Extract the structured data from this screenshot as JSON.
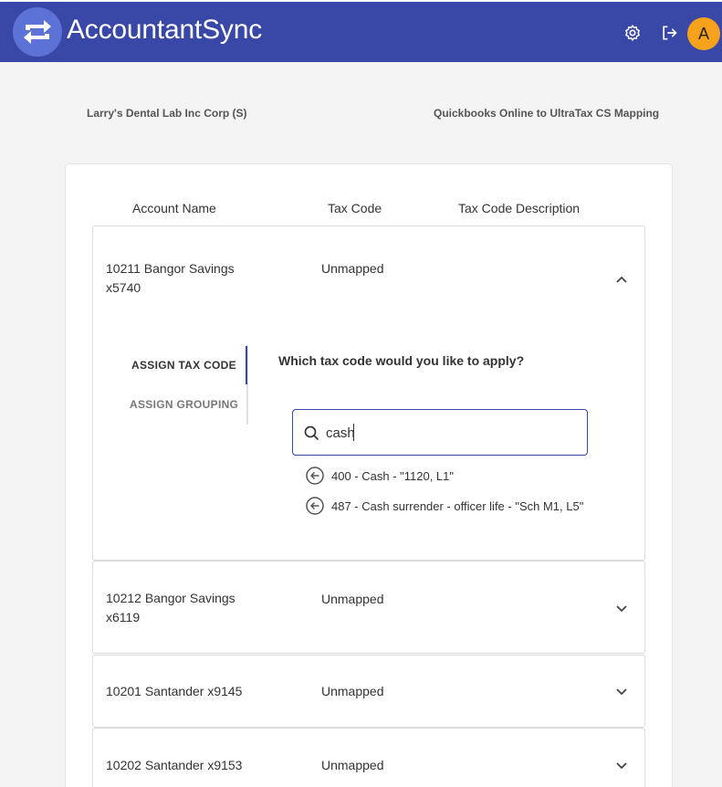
{
  "header": {
    "app_title": "AccountantSync",
    "avatar_initial": "A",
    "colors": {
      "bar": "#3947a6",
      "avatar": "#f7a21c"
    }
  },
  "client": {
    "name": "Larry's Dental Lab Inc Corp (S)",
    "mapping_title": "Quickbooks Online to UltraTax CS Mapping"
  },
  "table": {
    "columns": [
      "Account Name",
      "Tax Code",
      "Tax Code Description"
    ],
    "rows": [
      {
        "account_line1": "10211 Bangor Savings",
        "account_line2": "x5740",
        "tax_code": "Unmapped",
        "expanded": true
      },
      {
        "account_line1": "10212 Bangor Savings",
        "account_line2": "x6119",
        "tax_code": "Unmapped",
        "expanded": false
      },
      {
        "account_line1": "10201 Santander x9145",
        "account_line2": "",
        "tax_code": "Unmapped",
        "expanded": false
      },
      {
        "account_line1": "10202 Santander x9153",
        "account_line2": "",
        "tax_code": "Unmapped",
        "expanded": false
      }
    ]
  },
  "assign": {
    "tabs": [
      "ASSIGN TAX CODE",
      "ASSIGN GROUPING"
    ],
    "active_tab": "ASSIGN TAX CODE",
    "question": "Which tax code would you like to apply?",
    "search_value": "cash",
    "results": [
      "400 - Cash - \"1120, L1\"",
      "487 - Cash surrender - officer life - \"Sch M1, L5\""
    ]
  }
}
